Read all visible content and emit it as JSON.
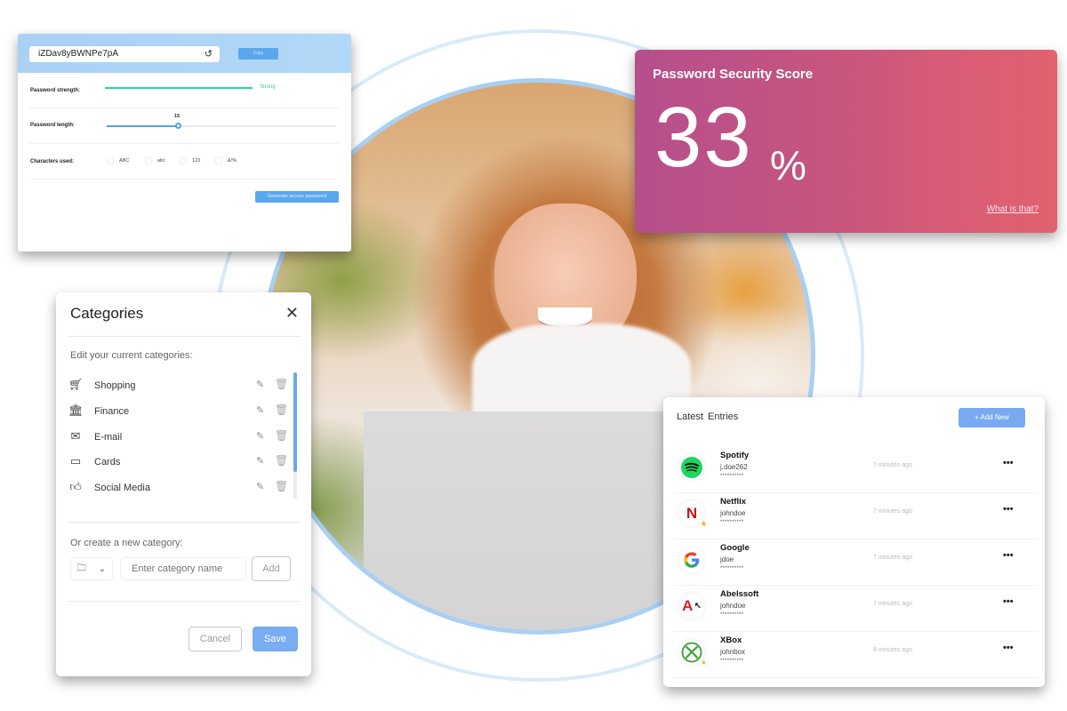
{
  "generator": {
    "password_value": "iZDav8yBWNPe7pA",
    "copy_label": "Copy",
    "strength_label": "Password strength:",
    "strength_value": "Strong",
    "strength_color": "#21d9a0",
    "length_label": "Password length:",
    "length_value": "15",
    "length_fraction": 0.31,
    "chars_label": "Characters used:",
    "char_options": [
      {
        "label": "ABC",
        "checked": false
      },
      {
        "label": "abc",
        "checked": false
      },
      {
        "label": "123",
        "checked": false
      },
      {
        "label": "&!%",
        "checked": false
      }
    ],
    "generate_label": "Generate secure password"
  },
  "score": {
    "title": "Password Security Score",
    "value": "33",
    "unit": "%",
    "link_label": "What is that?"
  },
  "categories": {
    "title": "Categories",
    "edit_label": "Edit your current categories:",
    "items": [
      {
        "label": "Shopping",
        "icon": "cart-icon"
      },
      {
        "label": "Finance",
        "icon": "bank-icon"
      },
      {
        "label": "E-mail",
        "icon": "envelope-icon"
      },
      {
        "label": "Cards",
        "icon": "credit-card-icon"
      },
      {
        "label": "Social Media",
        "icon": "thumbs-up-icon"
      }
    ],
    "create_label": "Or create a new category:",
    "new_name_placeholder": "Enter category name",
    "add_label": "Add",
    "cancel_label": "Cancel",
    "save_label": "Save"
  },
  "entries": {
    "title": "Latest  Entries",
    "add_label": "Add New",
    "rows": [
      {
        "name": "Spotify",
        "user": "j.doe262",
        "password": "**********",
        "time": "7 minutes ago",
        "logo": "spotify-logo",
        "favorite": false
      },
      {
        "name": "Netflix",
        "user": "johndoe",
        "password": "**********",
        "time": "7 minutes ago",
        "logo": "netflix-logo",
        "favorite": true
      },
      {
        "name": "Google",
        "user": "jdoe",
        "password": "**********",
        "time": "7 minutes ago",
        "logo": "google-logo",
        "favorite": false
      },
      {
        "name": "Abelssoft",
        "user": "johndoe",
        "password": "**********",
        "time": "7 minutes ago",
        "logo": "abelssoft-logo",
        "favorite": false
      },
      {
        "name": "XBox",
        "user": "johnbox",
        "password": "**********",
        "time": "8 minutes ago",
        "logo": "xbox-logo",
        "favorite": true
      }
    ]
  },
  "colors": {
    "accent_blue": "#77aaf2",
    "score_gradient_start": "#b54f8c",
    "score_gradient_end": "#e0626f"
  }
}
